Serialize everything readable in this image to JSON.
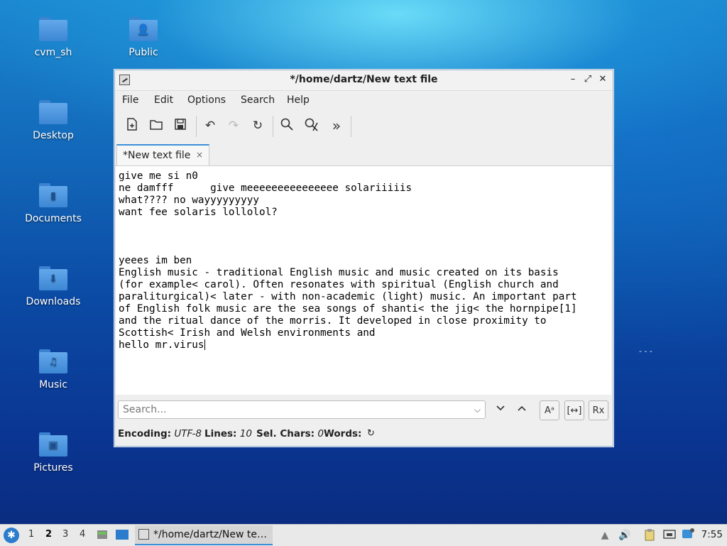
{
  "desktop": {
    "icons": [
      {
        "label": "cvm_sh",
        "glyph": ""
      },
      {
        "label": "Public",
        "glyph": "👤"
      },
      {
        "label": "Desktop",
        "glyph": ""
      },
      {
        "label": "Documents",
        "glyph": "▮"
      },
      {
        "label": "Downloads",
        "glyph": "⬇"
      },
      {
        "label": "Music",
        "glyph": "♫"
      },
      {
        "label": "Pictures",
        "glyph": "▣"
      }
    ],
    "stray_text": "- - -"
  },
  "window": {
    "title": "*/home/dartz/New text file",
    "controls": {
      "minimize": "–",
      "maximize": "⤢",
      "close": "✕"
    },
    "menu": [
      "File",
      "Edit",
      "Options",
      "Search",
      "Help"
    ],
    "toolbar": {
      "new": "new-file-icon",
      "open": "open-file-icon",
      "save": "save-icon",
      "undo": "undo-icon",
      "redo": "redo-icon",
      "reload": "reload-icon",
      "find": "search-icon",
      "replace": "replace-icon",
      "more": "more-icon"
    },
    "tab": {
      "label": "*New text file",
      "close": "×"
    },
    "editor_lines": [
      "give me si n0",
      "ne damfff      give meeeeeeeeeeeeeee solariiiiis",
      "what???? no wayyyyyyyyy",
      "want fee solaris lollolol?",
      "",
      "",
      "",
      "yeees im ben",
      "English music - traditional English music and music created on its basis",
      "(for example< carol). Often resonates with spiritual (English church and",
      "paraliturgical)< later - with non-academic (light) music. An important part",
      "of English folk music are the sea songs of shanti< the jig< the hornpipe[1]",
      "and the ritual dance of the morris. It developed in close proximity to",
      "Scottish< Irish and Welsh environments and",
      "hello mr.virus"
    ],
    "search": {
      "placeholder": "Search...",
      "match_case": "Aᵃ",
      "whole_word": "[↔]",
      "regex": "Rx"
    },
    "status": {
      "encoding_label": "Encoding:",
      "encoding_value": "UTF-8",
      "lines_label": "Lines:",
      "lines_value": "10",
      "sel_label": "Sel. Chars:",
      "sel_value": "0",
      "words_label": "Words:"
    }
  },
  "taskbar": {
    "workspaces": [
      "1",
      "2",
      "3",
      "4"
    ],
    "active_workspace": "2",
    "task_label": "*/home/dartz/New te…",
    "clock": "7:55"
  }
}
